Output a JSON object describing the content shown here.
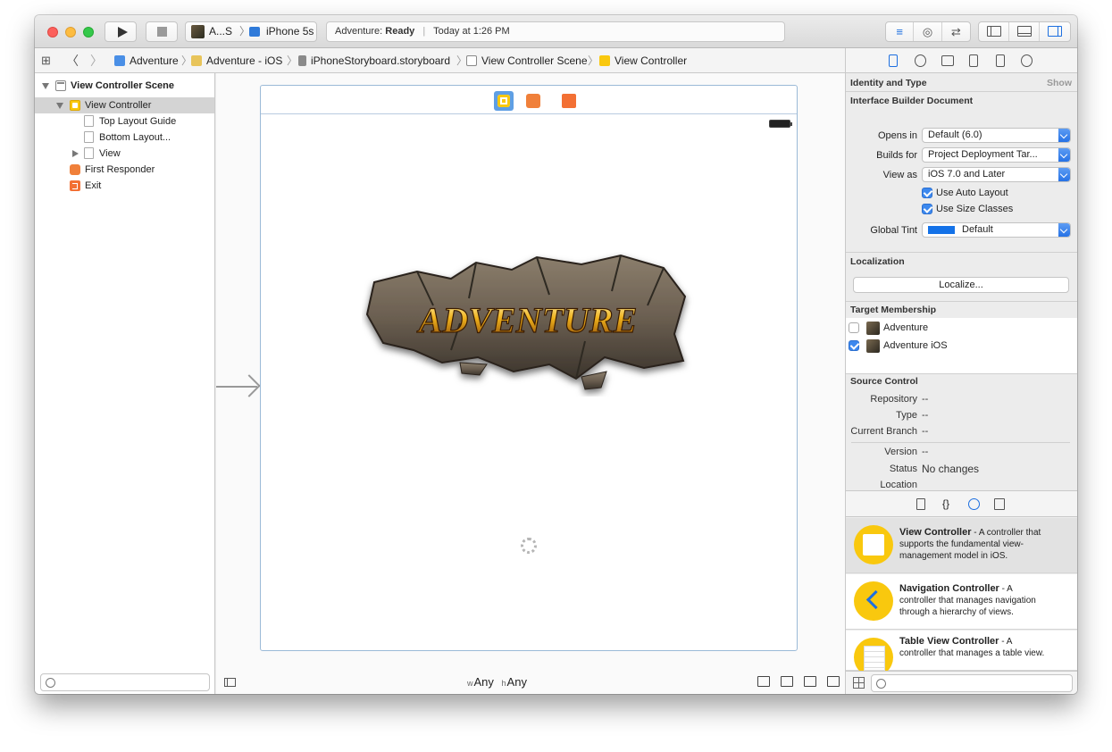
{
  "toolbar": {
    "scheme_app": "A...S",
    "scheme_device": "iPhone 5s",
    "activity_prefix": "Adventure:",
    "activity_status": "Ready",
    "activity_time": "Today at 1:26 PM"
  },
  "jumpbar": {
    "crumbs": [
      "Adventure",
      "Adventure - iOS",
      "iPhoneStoryboard.storyboard",
      "View Controller Scene",
      "View Controller"
    ]
  },
  "outline": {
    "items": [
      "View Controller Scene",
      "View Controller",
      "Top Layout Guide",
      "Bottom Layout...",
      "View",
      "First Responder",
      "Exit"
    ]
  },
  "canvas": {
    "logo_text": "ADVENTURE",
    "size_w_prefix": "w",
    "size_w": "Any",
    "size_h_prefix": "h",
    "size_h": "Any"
  },
  "inspector": {
    "identity_header": "Identity and Type",
    "show_label": "Show",
    "ibd_header": "Interface Builder Document",
    "opens_in_label": "Opens in",
    "opens_in_value": "Default (6.0)",
    "builds_for_label": "Builds for",
    "builds_for_value": "Project Deployment Tar...",
    "view_as_label": "View as",
    "view_as_value": "iOS 7.0 and Later",
    "auto_layout_label": "Use Auto Layout",
    "size_classes_label": "Use Size Classes",
    "global_tint_label": "Global Tint",
    "global_tint_value": "Default",
    "tint_color": "#1472e8",
    "localization_header": "Localization",
    "localize_button": "Localize...",
    "target_header": "Target Membership",
    "target_1": "Adventure",
    "target_2": "Adventure iOS",
    "source_header": "Source Control",
    "repository_label": "Repository",
    "repository_value": "--",
    "type_label": "Type",
    "type_value": "--",
    "branch_label": "Current Branch",
    "branch_value": "--",
    "version_label": "Version",
    "version_value": "--",
    "status_label": "Status",
    "status_value": "No changes",
    "location_label": "Location"
  },
  "library": {
    "items": [
      {
        "title": "View Controller",
        "desc_1": " - A controller that",
        "desc_2": "supports the fundamental view-",
        "desc_3": "management model in iOS."
      },
      {
        "title": "Navigation Controller",
        "desc_1": " - A",
        "desc_2": "controller that manages navigation",
        "desc_3": "through a hierarchy of views."
      },
      {
        "title": "Table View Controller",
        "desc_1": " - A",
        "desc_2": "controller that manages a table view.",
        "desc_3": ""
      }
    ]
  }
}
